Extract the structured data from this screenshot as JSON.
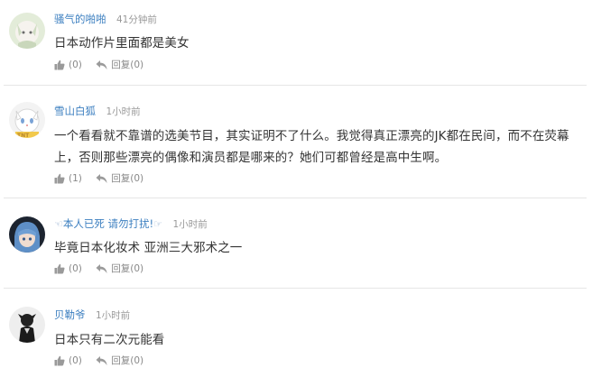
{
  "comments": [
    {
      "username": "骚气的啪啪",
      "time": "41分钟前",
      "content": "日本动作片里面都是美女",
      "like_count": "(0)",
      "reply_label": "回复",
      "reply_count": "(0)"
    },
    {
      "username": "雪山白狐",
      "time": "1小时前",
      "content_line1": "一个看看就不靠谱的选美节目，其实证明不了什么。我觉得真正漂亮的JK都在民间，而不在荧幕",
      "content_line2": "上，否则那些漂亮的偶像和演员都是哪来的？她们可都曾经是高中生啊。",
      "like_count": "(1)",
      "reply_label": "回复",
      "reply_count": "(0)"
    },
    {
      "username_prefix": "☜",
      "username": "本人已死  请勿打扰!",
      "username_suffix": "☞",
      "time": "1小时前",
      "content": "毕竟日本化妆术  亚洲三大邪术之一",
      "like_count": "(0)",
      "reply_label": "回复",
      "reply_count": "(0)"
    },
    {
      "username": "贝勒爷",
      "time": "1小时前",
      "content": "日本只有二次元能看",
      "like_count": "(0)",
      "reply_label": "回复",
      "reply_count": "(0)"
    }
  ],
  "icons": {
    "like": "thumbs-up-icon",
    "reply": "reply-arrow-icon"
  },
  "colors": {
    "username": "#3c7fc0",
    "meta_gray": "#999999",
    "text": "#333333",
    "divider": "#e6e6e6"
  }
}
